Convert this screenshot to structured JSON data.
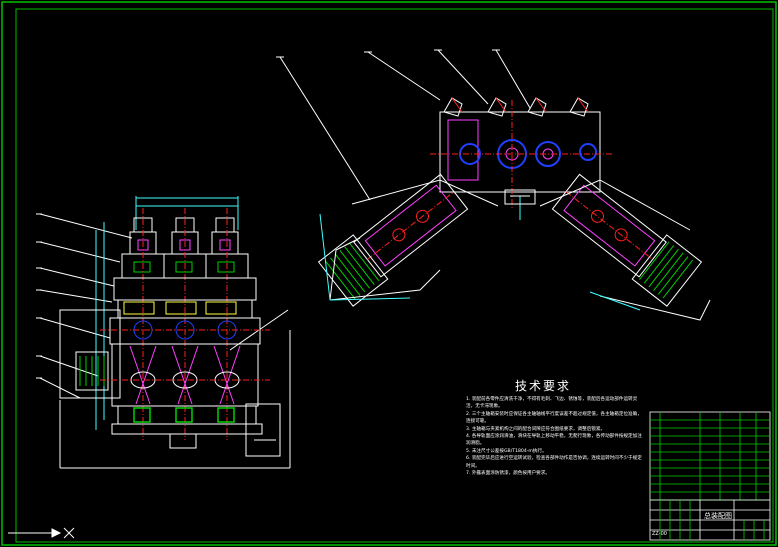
{
  "drawing": {
    "frame_color": "#00c000",
    "line_colors": {
      "outline": "#ffffff",
      "center": "#ff2020",
      "hidden": "#ff40ff",
      "dimension": "#40ffff",
      "part": "#2040ff",
      "fill_green": "#00d000",
      "yellow": "#ffff40"
    }
  },
  "tech_requirements": {
    "title": "技术要求",
    "notes": [
      "1. 装配前各零件应清洗干净，不得有毛刺、飞边、锈蚀等，装配后各运动部件运转灵活，无卡滞现象。",
      "2. 三个主轴箱安装时应保证各主轴轴线平行度误差不超过规定值，各主轴箱定位准确，连接可靠。",
      "3. 主轴箱与夹紧机构之间的配合间隙应符合图纸要求，调整后锁紧。",
      "4. 各导轨面应涂润滑油，滑块在导轨上移动平稳，无爬行现象，各传动部件按规定加注润滑脂。",
      "5. 未注尺寸公差按GB/T1804-m执行。",
      "6. 装配完毕后应进行空运转试验，检查各部件动作是否协调，连续运转时间不少于规定时间。",
      "7. 外露表面涂防锈漆，颜色按用户要求。"
    ]
  },
  "title_block": {
    "name_label": "总装配图",
    "drawing_no": "ZZ-00"
  }
}
